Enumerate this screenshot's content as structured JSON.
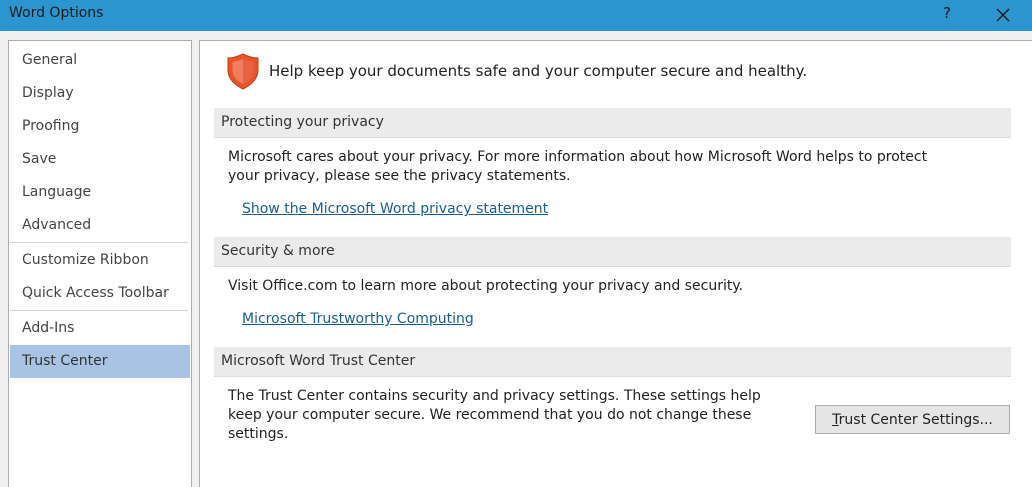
{
  "window": {
    "title": "Word Options",
    "help_label": "?",
    "accent_color": "#2b95d0"
  },
  "sidebar": {
    "items": [
      {
        "label": "General",
        "selected": false
      },
      {
        "label": "Display",
        "selected": false
      },
      {
        "label": "Proofing",
        "selected": false
      },
      {
        "label": "Save",
        "selected": false
      },
      {
        "label": "Language",
        "selected": false
      },
      {
        "label": "Advanced",
        "selected": false
      },
      {
        "label": "Customize Ribbon",
        "selected": false
      },
      {
        "label": "Quick Access Toolbar",
        "selected": false
      },
      {
        "label": "Add-Ins",
        "selected": false
      },
      {
        "label": "Trust Center",
        "selected": true
      }
    ]
  },
  "main": {
    "headline": "Help keep your documents safe and your computer secure and healthy.",
    "headline_icon": "shield-icon",
    "sections": [
      {
        "header": "Protecting your privacy",
        "text_line1": "Microsoft cares about your privacy. For more information about how Microsoft Word helps to protect",
        "text_line2": "your privacy, please see the privacy statements.",
        "link": "Show the Microsoft Word privacy statement"
      },
      {
        "header": "Security & more",
        "text_line1": "Visit Office.com to learn more about protecting your privacy and security.",
        "link": "Microsoft Trustworthy Computing"
      },
      {
        "header": "Microsoft Word Trust Center",
        "text_line1": "The Trust Center contains security and privacy settings. These settings help",
        "text_line2": "keep your computer secure. We recommend that you do not change these",
        "text_line3": "settings."
      }
    ],
    "trust_center_button": {
      "accel": "T",
      "rest": "rust Center Settings..."
    }
  }
}
